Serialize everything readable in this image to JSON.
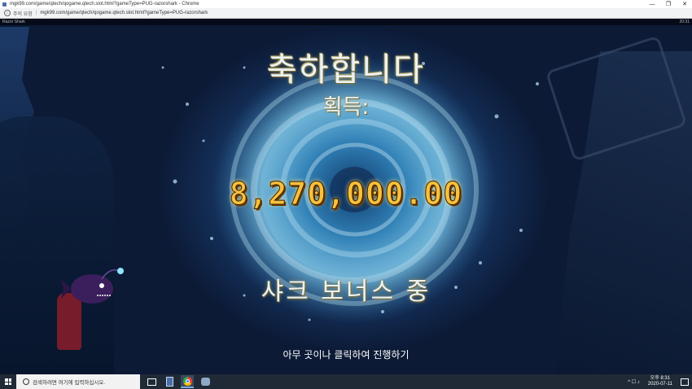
{
  "window": {
    "title": "mgk99.com/game/qtech/qogame.qtech.slot.html?gameType=PUG-razorshark - Chrome",
    "controls": [
      "—",
      "❐",
      "✕"
    ]
  },
  "addressbar": {
    "security_label": "주의 요함",
    "url": "mgk99.com/game/qtech/qogame.qtech.slot.html?gameType=PUG-razorshark"
  },
  "game": {
    "name": "Razor Shark",
    "clock": "20:31",
    "congrats": "축하합니다",
    "won_label": "획득:",
    "amount": "8,270,000.00",
    "bonus_label": "샤크 보너스 중",
    "hint": "아무 곳이나 클릭하여 진행하기"
  },
  "taskbar": {
    "search_placeholder": "검색하려면 여기에 입력하십시오.",
    "apps": [
      "task-view",
      "calculator",
      "chrome",
      "other"
    ],
    "tray_icons": "^ ☐ ♪",
    "time": "오후 8:31",
    "date": "2020-07-11"
  },
  "colors": {
    "accent_gold": "#f7c13c",
    "taskbar": "#1f2a36"
  }
}
